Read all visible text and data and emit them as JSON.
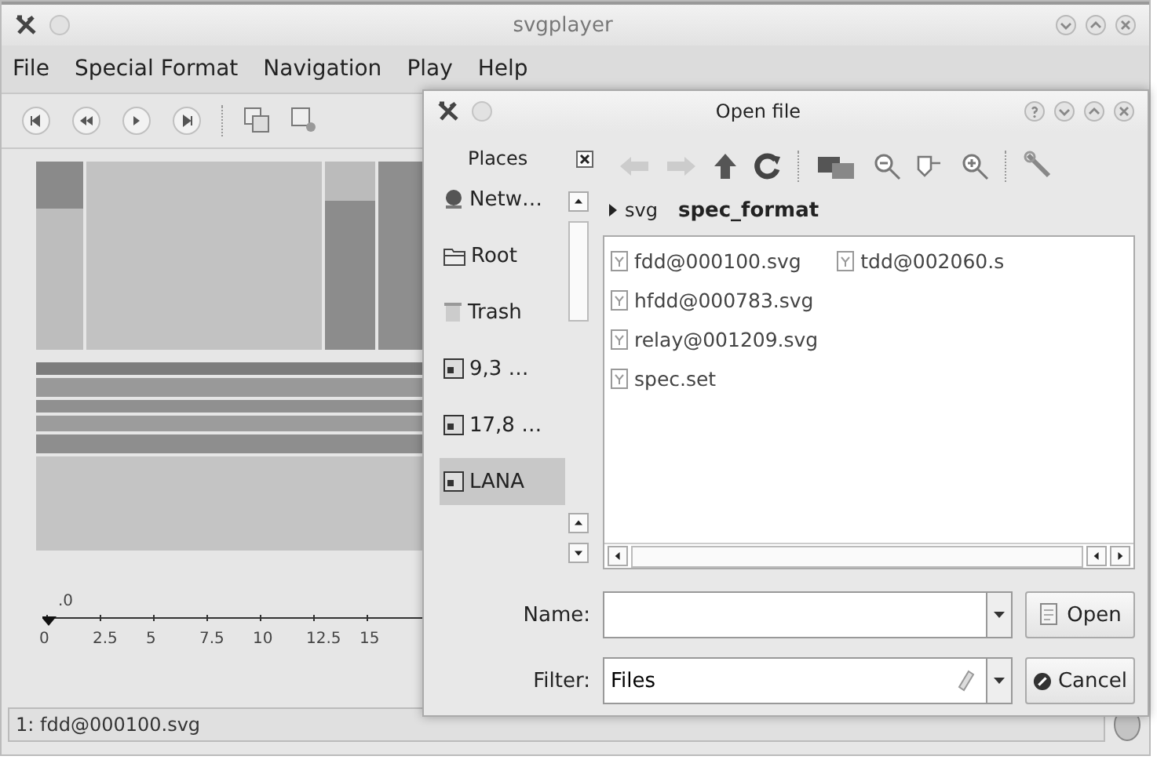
{
  "window": {
    "title": "svgplayer"
  },
  "menu": [
    {
      "label": "File"
    },
    {
      "label": "Special Format"
    },
    {
      "label": "Navigation"
    },
    {
      "label": "Play"
    },
    {
      "label": "Help"
    }
  ],
  "timeline": {
    "marker_label": ".0",
    "ticks": [
      "0",
      "2.5",
      "5",
      "7.5",
      "10",
      "12.5",
      "15"
    ]
  },
  "status_bar": {
    "text": "1: fdd@000100.svg"
  },
  "dialog": {
    "title": "Open file",
    "places": {
      "title": "Places",
      "items": [
        {
          "label": "Netw…",
          "kind": "network",
          "selected": false
        },
        {
          "label": "Root",
          "kind": "folder",
          "selected": false
        },
        {
          "label": "Trash",
          "kind": "trash",
          "selected": false
        },
        {
          "label": "9,3 …",
          "kind": "drive",
          "selected": false
        },
        {
          "label": "17,8 …",
          "kind": "drive",
          "selected": false
        },
        {
          "label": "LANA",
          "kind": "drive",
          "selected": true
        }
      ]
    },
    "breadcrumb": [
      "svg",
      "spec_format"
    ],
    "files": [
      "fdd@000100.svg",
      "hfdd@000783.svg",
      "relay@001209.svg",
      "spec.set",
      "tdd@002060.s"
    ],
    "name": {
      "label": "Name:"
    },
    "filter": {
      "label": "Filter:",
      "value": "Files"
    },
    "buttons": [
      {
        "label": "Open",
        "kind": "open"
      },
      {
        "label": "Cancel",
        "kind": "cancel"
      }
    ]
  }
}
